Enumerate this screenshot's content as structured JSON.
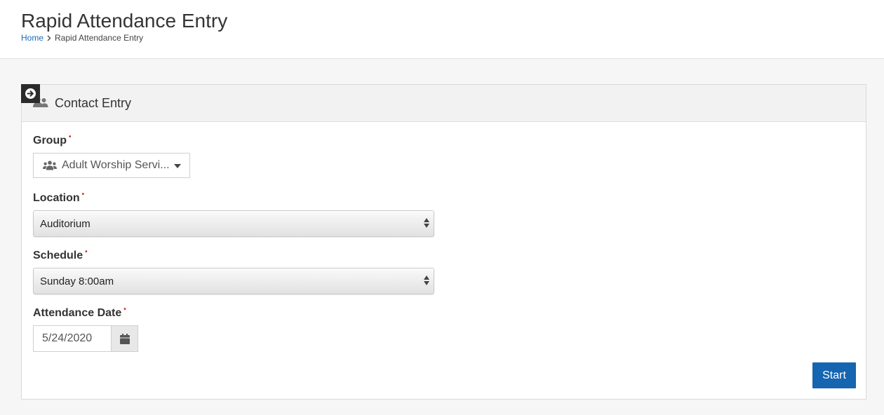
{
  "header": {
    "title": "Rapid Attendance Entry",
    "breadcrumb": {
      "home": "Home",
      "current": "Rapid Attendance Entry"
    }
  },
  "panel": {
    "title": "Contact Entry",
    "icons": {
      "toggle": "arrow-circle-right-icon",
      "heading": "users-icon"
    }
  },
  "form": {
    "group": {
      "label": "Group",
      "value": "Adult Worship Servi...",
      "icon": "users-icon"
    },
    "location": {
      "label": "Location",
      "value": "Auditorium"
    },
    "schedule": {
      "label": "Schedule",
      "value": "Sunday 8:00am"
    },
    "attendance_date": {
      "label": "Attendance Date",
      "value": "5/24/2020",
      "icon": "calendar-icon"
    },
    "required_marker": "•",
    "start_label": "Start"
  },
  "colors": {
    "accent": "#1565b0",
    "link": "#1a6bb5",
    "required": "#d32f2f"
  }
}
